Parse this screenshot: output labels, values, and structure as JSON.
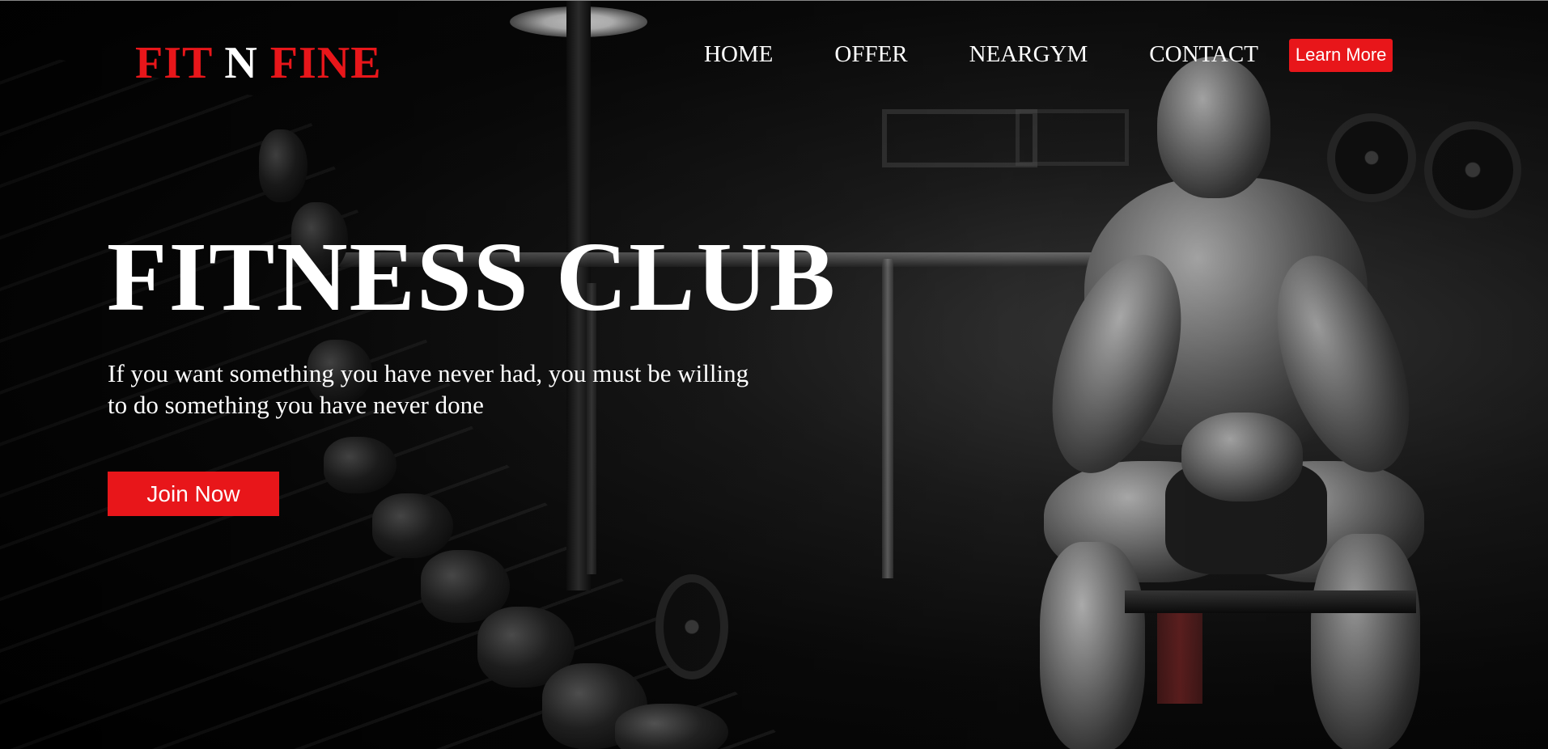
{
  "logo": {
    "part1": "FIT",
    "part2": "N",
    "part3": "FINE"
  },
  "nav": {
    "items": [
      {
        "label": "HOME"
      },
      {
        "label": "OFFER"
      },
      {
        "label": "NEARGYM"
      },
      {
        "label": "CONTACT"
      }
    ],
    "cta_label": "Learn More"
  },
  "hero": {
    "title": "FITNESS CLUB",
    "subtitle_line1": "If you want something you have never had, you must be willing",
    "subtitle_line2": "to do something you have never done",
    "button_label": "Join Now"
  },
  "colors": {
    "accent": "#e8161a",
    "text": "#ffffff",
    "background": "#000000"
  }
}
